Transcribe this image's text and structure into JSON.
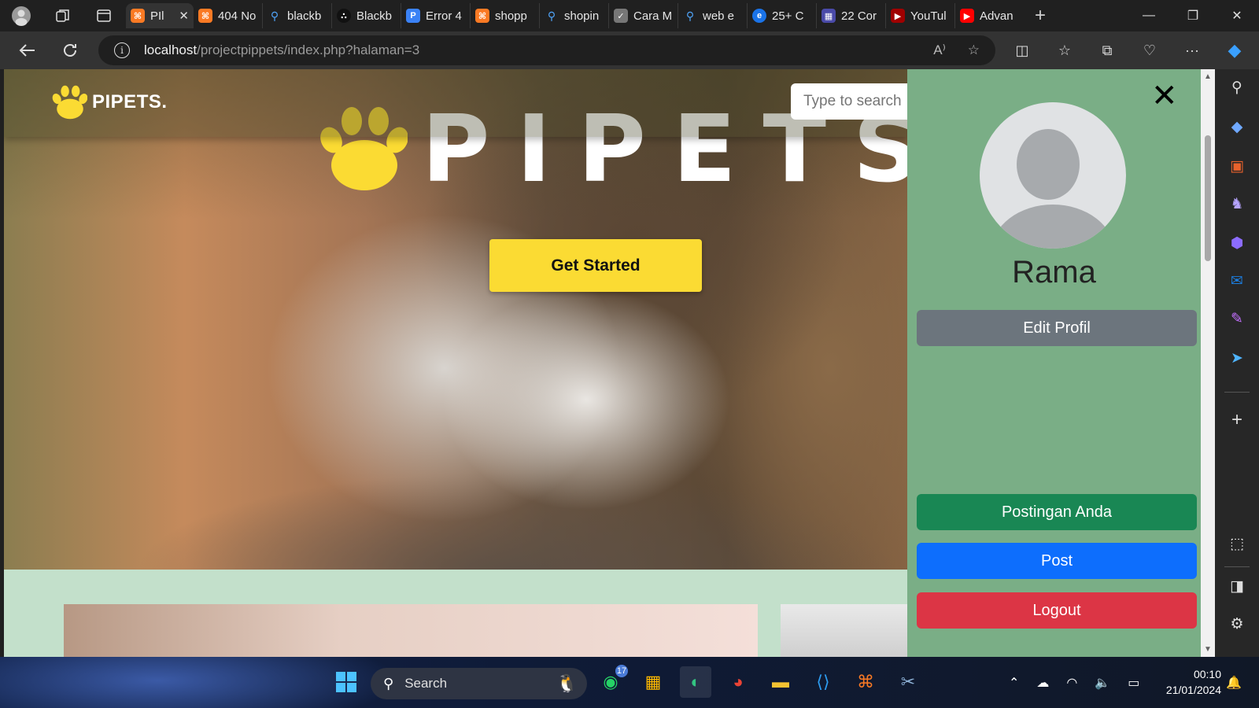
{
  "browser": {
    "tabs": [
      {
        "label": "PIl",
        "favicon": "xampp",
        "color": "#fb7a24",
        "active": true
      },
      {
        "label": "404 No",
        "favicon": "xampp",
        "color": "#fb7a24"
      },
      {
        "label": "blackb",
        "favicon": "search",
        "color": "#4fa3f7"
      },
      {
        "label": "Blackb",
        "favicon": "blackbox",
        "color": "#111111"
      },
      {
        "label": "Error 4",
        "favicon": "p-app",
        "color": "#3b82f6"
      },
      {
        "label": "shopp",
        "favicon": "xampp",
        "color": "#fb7a24"
      },
      {
        "label": "shopin",
        "favicon": "search",
        "color": "#4fa3f7"
      },
      {
        "label": "Cara M",
        "favicon": "checkmark",
        "color": "#777777"
      },
      {
        "label": "web e",
        "favicon": "search",
        "color": "#4fa3f7"
      },
      {
        "label": "25+ C",
        "favicon": "e-site",
        "color": "#1a73e8"
      },
      {
        "label": "22 Cor",
        "favicon": "grid-site",
        "color": "#4a4aa8"
      },
      {
        "label": "YouTul",
        "favicon": "youtube",
        "color": "#cc0000"
      },
      {
        "label": "Advan",
        "favicon": "youtube",
        "color": "#ff0000"
      }
    ],
    "url_host": "localhost",
    "url_path": "/projectpippets/index.php?halaman=3"
  },
  "site": {
    "brand": "PIPETS.",
    "search_placeholder": "Type to search",
    "hero_title": "PIPETS",
    "cta_label": "Get Started",
    "brand_color": "#fbdb33"
  },
  "sidebar": {
    "user_name": "Rama",
    "edit_profile": "Edit Profil",
    "my_posts": "Postingan Anda",
    "post": "Post",
    "logout": "Logout",
    "bg_color": "#7aae86"
  },
  "taskbar": {
    "search_label": "Search",
    "whatsapp_badge": "17",
    "time": "00:10",
    "date": "21/01/2024"
  }
}
